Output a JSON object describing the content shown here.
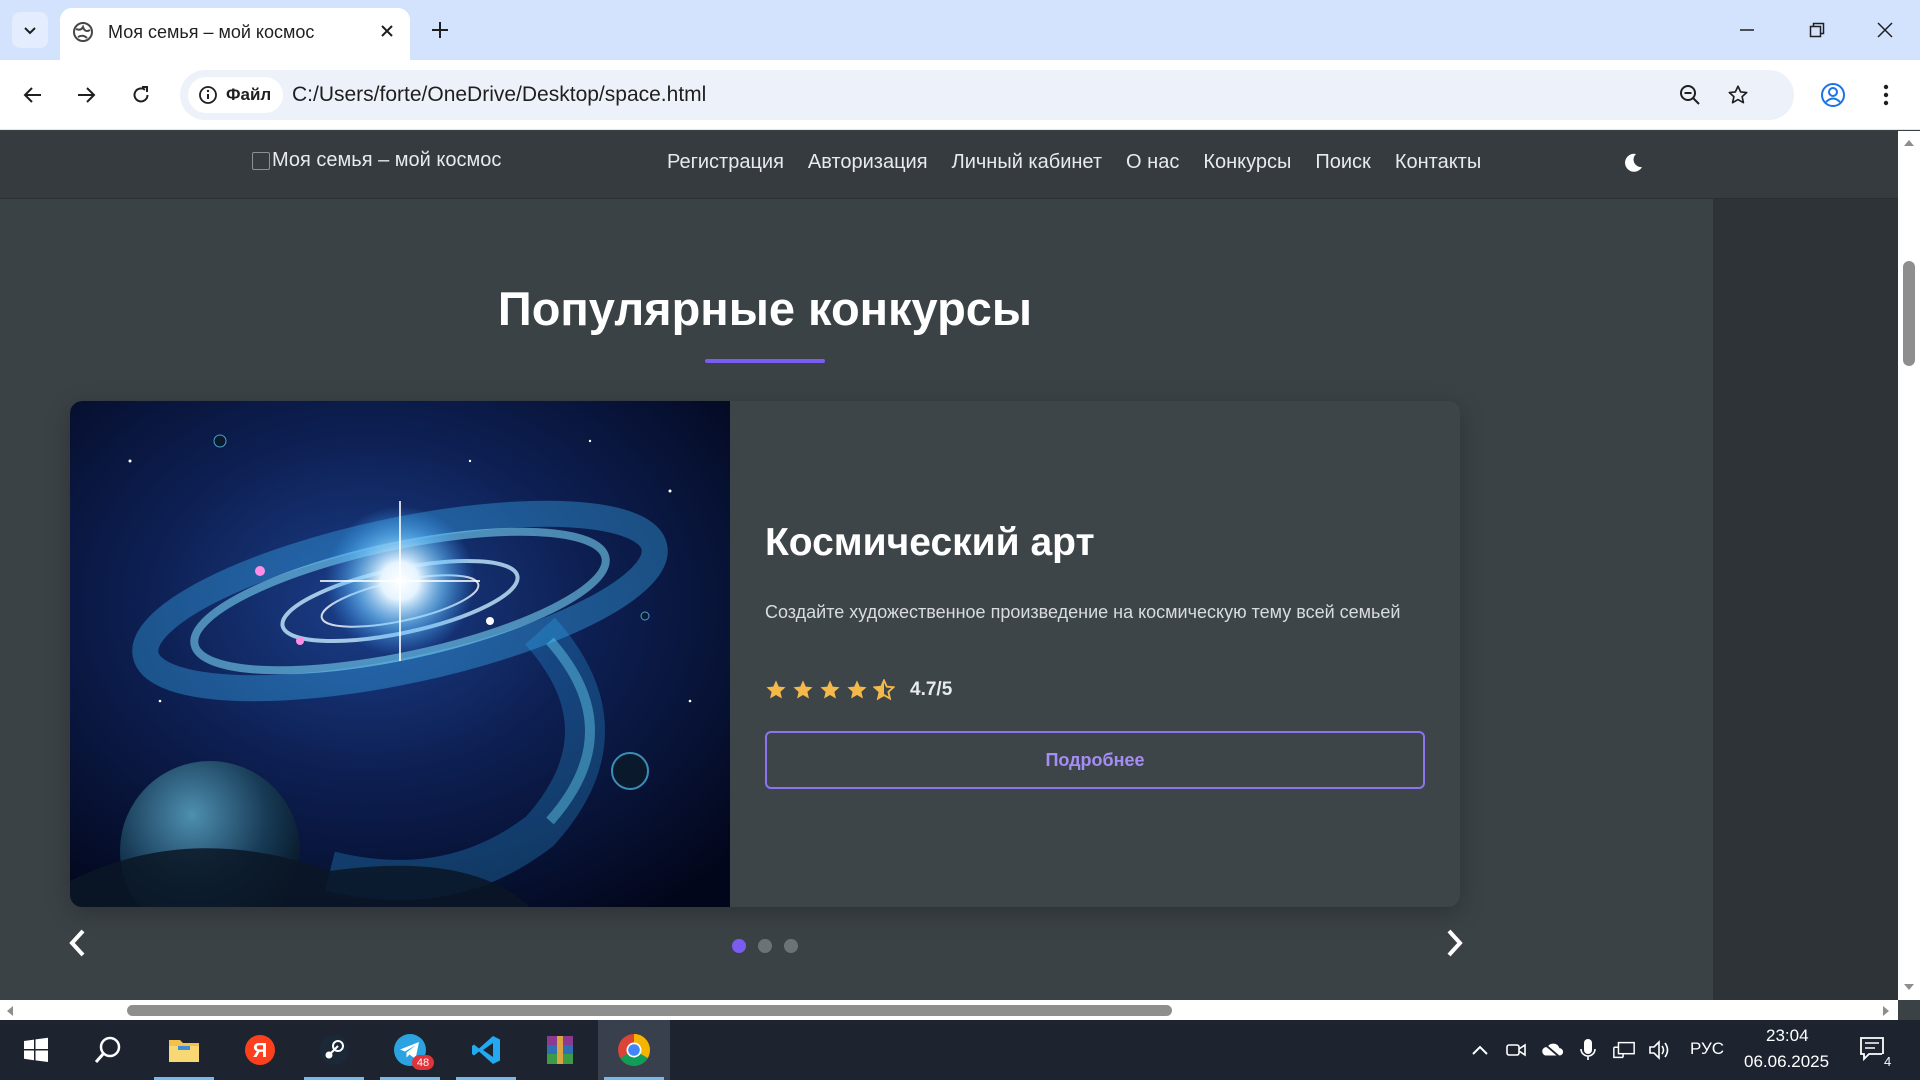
{
  "browser": {
    "tab_title": "Моя семья – мой космос",
    "site_chip_label": "Файл",
    "url": "C:/Users/forte/OneDrive/Desktop/space.html"
  },
  "site": {
    "logo_alt": "Моя семья – мой космос",
    "menu": [
      {
        "label": "Регистрация"
      },
      {
        "label": "Авторизация"
      },
      {
        "label": "Личный кабинет"
      },
      {
        "label": "О нас"
      },
      {
        "label": "Конкурсы"
      },
      {
        "label": "Поиск"
      },
      {
        "label": "Контакты"
      }
    ],
    "theme_icon": "moon-icon",
    "accent_color": "#7b5cf0"
  },
  "section": {
    "title": "Популярные конкурсы"
  },
  "carousel": {
    "active_slide": 1,
    "slide_count": 3,
    "card": {
      "title": "Космический арт",
      "description": "Создайте художественное произведение на космическую тему всей семьей",
      "rating_stars": 4.7,
      "rating_text": "4.7/5",
      "button_label": "Подробнее"
    }
  },
  "taskbar": {
    "apps": [
      "windows-start",
      "search",
      "file-explorer",
      "yandex-browser",
      "steam",
      "telegram",
      "vscode",
      "winrar",
      "chrome"
    ],
    "telegram_badge": "48",
    "language": "РУС",
    "time": "23:04",
    "date": "06.06.2025",
    "notifications_count": "4"
  }
}
